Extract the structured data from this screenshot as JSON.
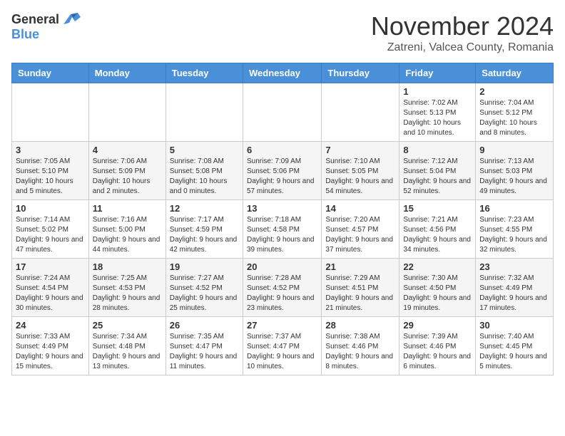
{
  "logo": {
    "general": "General",
    "blue": "Blue"
  },
  "title": "November 2024",
  "location": "Zatreni, Valcea County, Romania",
  "days_of_week": [
    "Sunday",
    "Monday",
    "Tuesday",
    "Wednesday",
    "Thursday",
    "Friday",
    "Saturday"
  ],
  "weeks": [
    [
      {
        "day": "",
        "info": ""
      },
      {
        "day": "",
        "info": ""
      },
      {
        "day": "",
        "info": ""
      },
      {
        "day": "",
        "info": ""
      },
      {
        "day": "",
        "info": ""
      },
      {
        "day": "1",
        "info": "Sunrise: 7:02 AM\nSunset: 5:13 PM\nDaylight: 10 hours and 10 minutes."
      },
      {
        "day": "2",
        "info": "Sunrise: 7:04 AM\nSunset: 5:12 PM\nDaylight: 10 hours and 8 minutes."
      }
    ],
    [
      {
        "day": "3",
        "info": "Sunrise: 7:05 AM\nSunset: 5:10 PM\nDaylight: 10 hours and 5 minutes."
      },
      {
        "day": "4",
        "info": "Sunrise: 7:06 AM\nSunset: 5:09 PM\nDaylight: 10 hours and 2 minutes."
      },
      {
        "day": "5",
        "info": "Sunrise: 7:08 AM\nSunset: 5:08 PM\nDaylight: 10 hours and 0 minutes."
      },
      {
        "day": "6",
        "info": "Sunrise: 7:09 AM\nSunset: 5:06 PM\nDaylight: 9 hours and 57 minutes."
      },
      {
        "day": "7",
        "info": "Sunrise: 7:10 AM\nSunset: 5:05 PM\nDaylight: 9 hours and 54 minutes."
      },
      {
        "day": "8",
        "info": "Sunrise: 7:12 AM\nSunset: 5:04 PM\nDaylight: 9 hours and 52 minutes."
      },
      {
        "day": "9",
        "info": "Sunrise: 7:13 AM\nSunset: 5:03 PM\nDaylight: 9 hours and 49 minutes."
      }
    ],
    [
      {
        "day": "10",
        "info": "Sunrise: 7:14 AM\nSunset: 5:02 PM\nDaylight: 9 hours and 47 minutes."
      },
      {
        "day": "11",
        "info": "Sunrise: 7:16 AM\nSunset: 5:00 PM\nDaylight: 9 hours and 44 minutes."
      },
      {
        "day": "12",
        "info": "Sunrise: 7:17 AM\nSunset: 4:59 PM\nDaylight: 9 hours and 42 minutes."
      },
      {
        "day": "13",
        "info": "Sunrise: 7:18 AM\nSunset: 4:58 PM\nDaylight: 9 hours and 39 minutes."
      },
      {
        "day": "14",
        "info": "Sunrise: 7:20 AM\nSunset: 4:57 PM\nDaylight: 9 hours and 37 minutes."
      },
      {
        "day": "15",
        "info": "Sunrise: 7:21 AM\nSunset: 4:56 PM\nDaylight: 9 hours and 34 minutes."
      },
      {
        "day": "16",
        "info": "Sunrise: 7:23 AM\nSunset: 4:55 PM\nDaylight: 9 hours and 32 minutes."
      }
    ],
    [
      {
        "day": "17",
        "info": "Sunrise: 7:24 AM\nSunset: 4:54 PM\nDaylight: 9 hours and 30 minutes."
      },
      {
        "day": "18",
        "info": "Sunrise: 7:25 AM\nSunset: 4:53 PM\nDaylight: 9 hours and 28 minutes."
      },
      {
        "day": "19",
        "info": "Sunrise: 7:27 AM\nSunset: 4:52 PM\nDaylight: 9 hours and 25 minutes."
      },
      {
        "day": "20",
        "info": "Sunrise: 7:28 AM\nSunset: 4:52 PM\nDaylight: 9 hours and 23 minutes."
      },
      {
        "day": "21",
        "info": "Sunrise: 7:29 AM\nSunset: 4:51 PM\nDaylight: 9 hours and 21 minutes."
      },
      {
        "day": "22",
        "info": "Sunrise: 7:30 AM\nSunset: 4:50 PM\nDaylight: 9 hours and 19 minutes."
      },
      {
        "day": "23",
        "info": "Sunrise: 7:32 AM\nSunset: 4:49 PM\nDaylight: 9 hours and 17 minutes."
      }
    ],
    [
      {
        "day": "24",
        "info": "Sunrise: 7:33 AM\nSunset: 4:49 PM\nDaylight: 9 hours and 15 minutes."
      },
      {
        "day": "25",
        "info": "Sunrise: 7:34 AM\nSunset: 4:48 PM\nDaylight: 9 hours and 13 minutes."
      },
      {
        "day": "26",
        "info": "Sunrise: 7:35 AM\nSunset: 4:47 PM\nDaylight: 9 hours and 11 minutes."
      },
      {
        "day": "27",
        "info": "Sunrise: 7:37 AM\nSunset: 4:47 PM\nDaylight: 9 hours and 10 minutes."
      },
      {
        "day": "28",
        "info": "Sunrise: 7:38 AM\nSunset: 4:46 PM\nDaylight: 9 hours and 8 minutes."
      },
      {
        "day": "29",
        "info": "Sunrise: 7:39 AM\nSunset: 4:46 PM\nDaylight: 9 hours and 6 minutes."
      },
      {
        "day": "30",
        "info": "Sunrise: 7:40 AM\nSunset: 4:45 PM\nDaylight: 9 hours and 5 minutes."
      }
    ]
  ]
}
